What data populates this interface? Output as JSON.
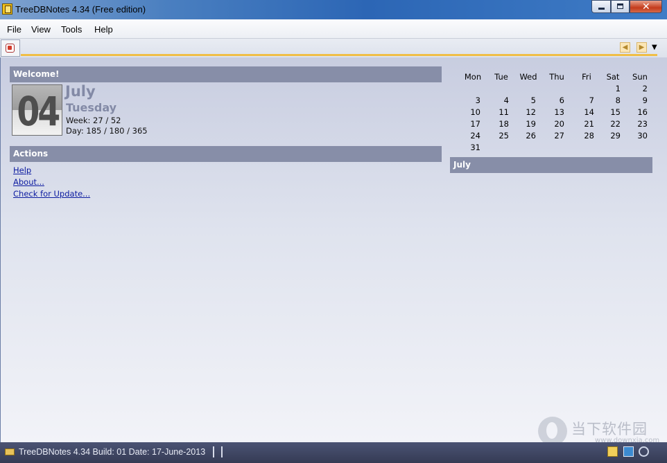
{
  "window": {
    "title": "TreeDBNotes 4.34 (Free edition)"
  },
  "menu": [
    "File",
    "View",
    "Tools",
    "Help"
  ],
  "welcome": {
    "header": "Welcome!",
    "day_number": "04",
    "month": "July",
    "weekday": "Tuesday",
    "week": "Week: 27 / 52",
    "day": "Day: 185 / 180 / 365"
  },
  "actions": {
    "header": "Actions",
    "links": [
      "Help",
      "About...",
      "Check for Update..."
    ]
  },
  "calendar": {
    "weekdays": [
      "Mon",
      "Tue",
      "Wed",
      "Thu",
      "Fri",
      "Sat",
      "Sun"
    ],
    "weeks": [
      [
        "",
        "",
        "",
        "",
        "",
        "1",
        "2"
      ],
      [
        "3",
        "4",
        "5",
        "6",
        "7",
        "8",
        "9"
      ],
      [
        "10",
        "11",
        "12",
        "13",
        "14",
        "15",
        "16"
      ],
      [
        "17",
        "18",
        "19",
        "20",
        "21",
        "22",
        "23"
      ],
      [
        "24",
        "25",
        "26",
        "27",
        "28",
        "29",
        "30"
      ],
      [
        "31",
        "",
        "",
        "",
        "",
        "",
        ""
      ]
    ],
    "month_header": "July"
  },
  "status": {
    "text": "TreeDBNotes 4.34 Build: 01 Date: 17-June-2013"
  },
  "watermark": {
    "text": "当下软件园",
    "url": "www.downxia.com"
  },
  "colors": {
    "section_header": "#878ea8",
    "accent_rule": "#f0be46",
    "link": "#0b1aa0",
    "date_text": "#838aa6"
  }
}
